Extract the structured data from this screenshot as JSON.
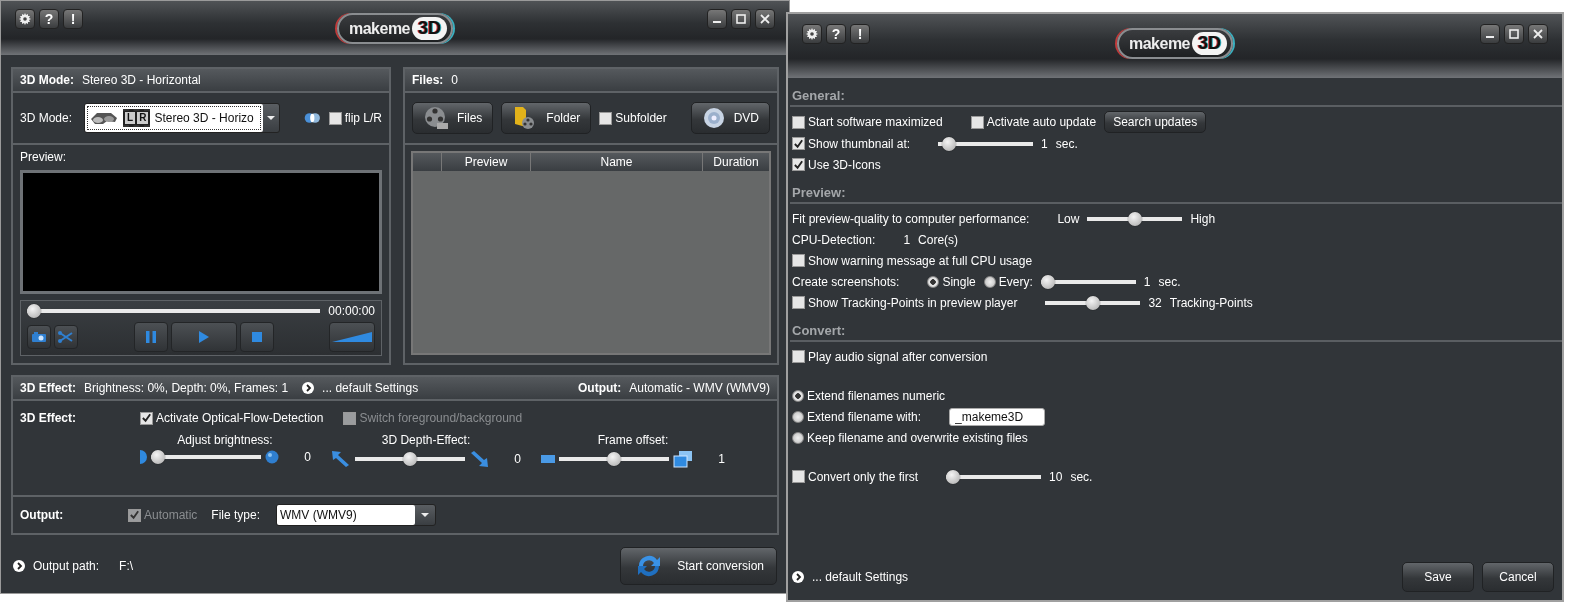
{
  "left_window": {
    "toolbar": [
      {
        "kind": "gear"
      },
      {
        "kind": "glyph",
        "label": "?"
      },
      {
        "kind": "glyph",
        "label": "!"
      }
    ],
    "logo": {
      "text": "makeme",
      "badge": "3D"
    },
    "window_controls": [
      {
        "kind": "minimize"
      },
      {
        "kind": "maximize"
      },
      {
        "kind": "close"
      }
    ],
    "mode_panel": {
      "header_label": "3D Mode:",
      "header_value": "Stereo 3D - Horizontal",
      "mode_label": "3D Mode:",
      "mode_select": {
        "left": "L",
        "right": "R",
        "value": "Stereo 3D - Horizo"
      },
      "flip": {
        "label": "flip L/R",
        "checked": false
      },
      "preview_label": "Preview:",
      "seek": {
        "level": 0
      },
      "time": "00:00:00",
      "player_groups": [
        [
          {
            "kind": "camera"
          },
          {
            "kind": "scissors"
          }
        ],
        [
          {
            "kind": "pause"
          },
          {
            "kind": "play"
          },
          {
            "kind": "stop"
          }
        ],
        [
          {
            "kind": "volume"
          }
        ]
      ]
    },
    "files_panel": {
      "header_label": "Files:",
      "header_value": "0",
      "buttons": [
        {
          "kind": "film",
          "label": "Files"
        },
        {
          "kind": "folder",
          "label": "Folder"
        }
      ],
      "subfolder": {
        "label": "Subfolder",
        "checked": false
      },
      "dvd": {
        "label": "DVD"
      },
      "columns": [
        "Preview",
        "Name",
        "Duration"
      ]
    },
    "effect_panel": {
      "header": {
        "label": "3D Effect:",
        "summary": "Brightness: 0%, Depth: 0%, Frames: 1",
        "link": "... default Settings",
        "output_label": "Output:",
        "output_value": "Automatic - WMV (WMV9)"
      },
      "label": "3D Effect:",
      "options": [
        {
          "label": "Activate Optical-Flow-Detection",
          "checked": true,
          "disabled": false
        },
        {
          "label": "Switch foreground/background",
          "checked": false,
          "disabled": true
        }
      ],
      "sliders": [
        {
          "kind": "brightness",
          "title": "Adjust brightness:",
          "level": 0,
          "value": "0"
        },
        {
          "kind": "depth",
          "title": "3D Depth-Effect:",
          "level": 0.5,
          "value": "0"
        },
        {
          "kind": "frames",
          "title": "Frame offset:",
          "level": 0.5,
          "value": "1"
        }
      ],
      "output": {
        "label": "Output:",
        "automatic": {
          "label": "Automatic",
          "checked": true,
          "disabled": true
        },
        "file_type_label": "File type:",
        "file_type": "WMV (WMV9)"
      }
    },
    "footer": {
      "output_path_label": "Output path:",
      "output_path": "F:\\",
      "start_button": "Start conversion"
    }
  },
  "right_window": {
    "toolbar": [
      {
        "kind": "gear"
      },
      {
        "kind": "glyph",
        "label": "?"
      },
      {
        "kind": "glyph",
        "label": "!"
      }
    ],
    "logo": {
      "text": "makeme",
      "badge": "3D"
    },
    "window_controls": [
      {
        "kind": "minimize"
      },
      {
        "kind": "maximize"
      },
      {
        "kind": "close"
      }
    ],
    "sections": [
      {
        "title": "General:",
        "groups": [
          [
            [
              {
                "kind": "checkbox",
                "label": "Start software maximized",
                "checked": false
              },
              {
                "kind": "checkbox",
                "label": "Activate auto update",
                "checked": false
              },
              {
                "kind": "button",
                "label": "Search updates"
              }
            ],
            [
              {
                "kind": "checkbox",
                "label": "Show thumbnail at:",
                "checked": true
              },
              {
                "kind": "slider",
                "level": 0.05
              },
              {
                "kind": "text",
                "text": "1"
              },
              {
                "kind": "text",
                "text": "sec."
              }
            ],
            [
              {
                "kind": "checkbox",
                "label": "Use 3D-Icons",
                "checked": true
              }
            ]
          ]
        ]
      },
      {
        "title": "Preview:",
        "groups": [
          [
            [
              {
                "kind": "text",
                "text": "Fit preview-quality to computer performance:"
              },
              {
                "kind": "text",
                "text": "Low"
              },
              {
                "kind": "slider",
                "level": 0.5
              },
              {
                "kind": "text",
                "text": "High"
              }
            ],
            [
              {
                "kind": "text",
                "text": "CPU-Detection:"
              },
              {
                "kind": "text",
                "text": "1"
              },
              {
                "kind": "text",
                "text": "Core(s)"
              }
            ],
            [
              {
                "kind": "checkbox",
                "label": "Show warning message at full CPU usage",
                "checked": false
              }
            ],
            [
              {
                "kind": "text",
                "text": "Create screenshots:"
              },
              {
                "kind": "radio",
                "label": "Single",
                "selected": true
              },
              {
                "kind": "radio",
                "label": "Every:",
                "selected": false
              },
              {
                "kind": "slider",
                "level": 0
              },
              {
                "kind": "text",
                "text": "1"
              },
              {
                "kind": "text",
                "text": "sec."
              }
            ],
            [
              {
                "kind": "checkbox",
                "label": "Show Tracking-Points in preview player",
                "checked": false
              },
              {
                "kind": "slider",
                "level": 0.5
              },
              {
                "kind": "text",
                "text": "32"
              },
              {
                "kind": "text",
                "text": "Tracking-Points"
              }
            ]
          ]
        ]
      },
      {
        "title": "Convert:",
        "groups": [
          [
            [
              {
                "kind": "checkbox",
                "label": "Play audio signal after conversion",
                "checked": false
              }
            ]
          ],
          [
            [
              {
                "kind": "radio",
                "label": "Extend filenames numeric",
                "selected": true
              }
            ],
            [
              {
                "kind": "radio",
                "label": "Extend filename with:",
                "selected": false
              },
              {
                "kind": "input",
                "value": "_makeme3D"
              }
            ],
            [
              {
                "kind": "radio",
                "label": "Keep filename and overwrite existing files",
                "selected": false
              }
            ]
          ],
          [
            [
              {
                "kind": "checkbox",
                "label": "Convert only the first",
                "checked": false
              },
              {
                "kind": "slider",
                "level": 0
              },
              {
                "kind": "text",
                "text": "10"
              },
              {
                "kind": "text",
                "text": "sec."
              }
            ]
          ]
        ]
      }
    ],
    "footer": {
      "link": "... default Settings",
      "buttons": [
        "Save",
        "Cancel"
      ]
    }
  }
}
